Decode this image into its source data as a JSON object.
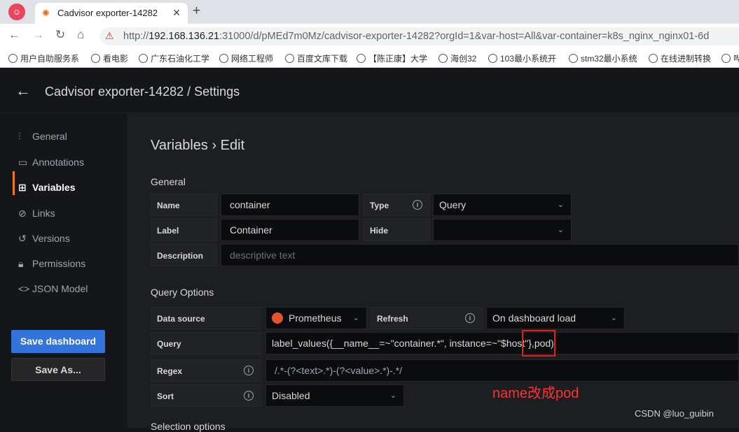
{
  "browser": {
    "tab_title": "Cadvisor exporter-14282",
    "url_prefix": "http://",
    "url_host": "192.168.136.21",
    "url_rest": ":31000/d/pMEd7m0Mz/cadvisor-exporter-14282?orgId=1&var-host=All&var-container=k8s_nginx_nginx01-6d",
    "bookmarks": [
      "用户自助服务系",
      "看电影",
      "广东石油化工学",
      "网络工程师",
      "百度文库下载",
      "【陈正康】大学",
      "海创32",
      "103最小系统开",
      "stm32最小系统",
      "在线进制转换",
      "哔"
    ]
  },
  "header": {
    "title": "Cadvisor exporter-14282 / Settings"
  },
  "sidebar": {
    "items": [
      {
        "label": "General",
        "icon": "sliders-icon"
      },
      {
        "label": "Annotations",
        "icon": "comment-icon"
      },
      {
        "label": "Variables",
        "icon": "calculator-icon"
      },
      {
        "label": "Links",
        "icon": "link-icon"
      },
      {
        "label": "Versions",
        "icon": "history-icon"
      },
      {
        "label": "Permissions",
        "icon": "lock-icon"
      },
      {
        "label": "JSON Model",
        "icon": "code-icon"
      }
    ],
    "save_label": "Save dashboard",
    "save_as_label": "Save As..."
  },
  "main": {
    "heading": "Variables › Edit",
    "general_title": "General",
    "name_label": "Name",
    "name_value": "container",
    "type_label": "Type",
    "type_value": "Query",
    "label_label": "Label",
    "label_value": "Container",
    "hide_label": "Hide",
    "hide_value": "",
    "description_label": "Description",
    "description_placeholder": "descriptive text",
    "query_options_title": "Query Options",
    "datasource_label": "Data source",
    "datasource_value": "Prometheus",
    "refresh_label": "Refresh",
    "refresh_value": "On dashboard load",
    "query_label": "Query",
    "query_value": "label_values({__name__=~\"container.*\", instance=~\"$host\"},pod)",
    "regex_label": "Regex",
    "regex_value": "/.*-(?<text>.*)-(?<value>.*)-.*/",
    "sort_label": "Sort",
    "sort_value": "Disabled",
    "selection_title": "Selection options"
  },
  "annotation": {
    "text": "name改成pod"
  },
  "watermark": "CSDN @luo_guibin",
  "colors": {
    "accent": "#3274d9",
    "active_marker": "#eb7b18",
    "annotation_red": "#e02020"
  }
}
